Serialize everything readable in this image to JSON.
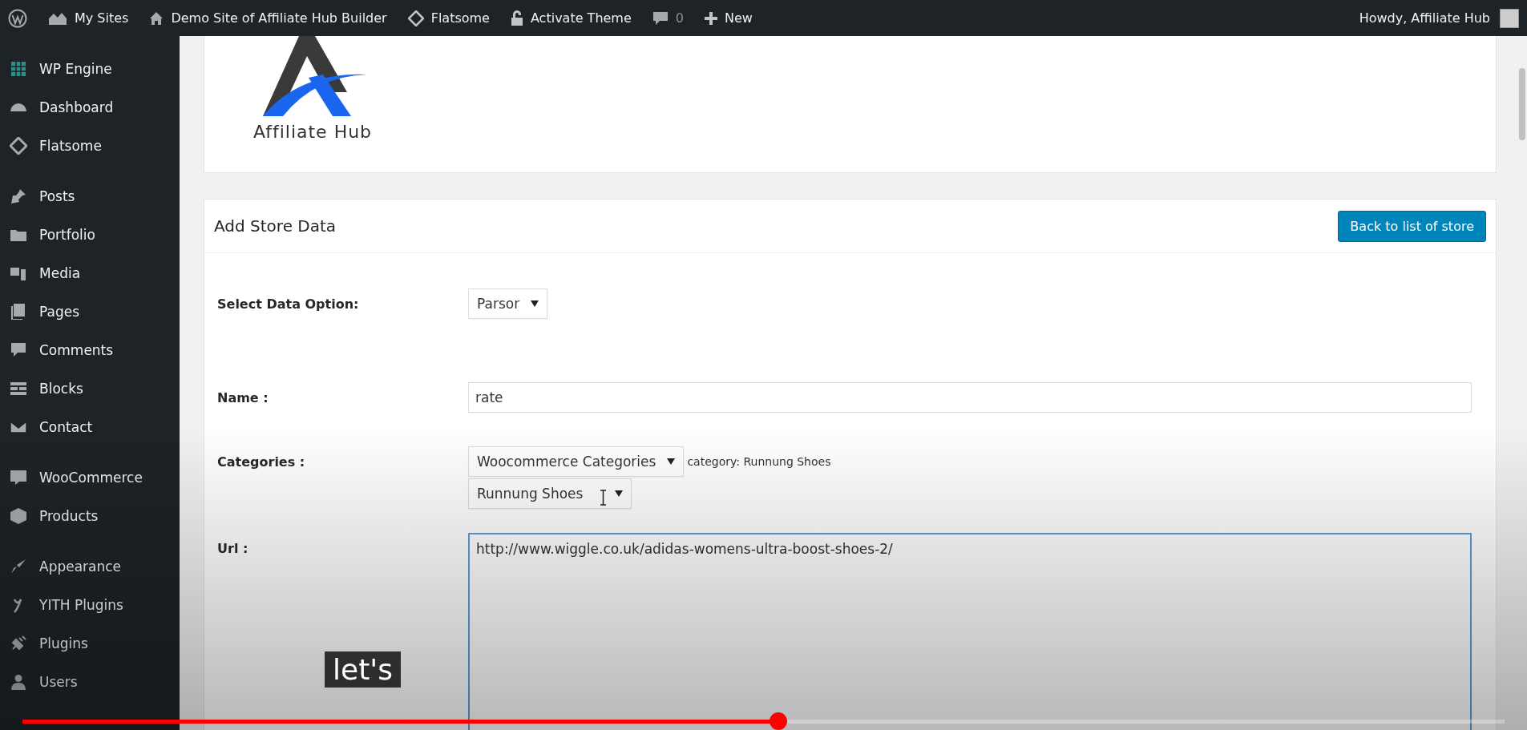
{
  "admin_bar": {
    "items": [
      {
        "kind": "logo"
      },
      {
        "kind": "sites",
        "label": "My Sites"
      },
      {
        "kind": "home",
        "label": "Demo Site of Affiliate Hub Builder"
      },
      {
        "kind": "flatsome",
        "label": "Flatsome"
      },
      {
        "kind": "lock",
        "label": "Activate Theme"
      },
      {
        "kind": "comments",
        "label": "0"
      },
      {
        "kind": "new",
        "label": "New"
      }
    ],
    "account": "Howdy, Affiliate Hub"
  },
  "sidebar": {
    "groups": [
      [
        {
          "label": "WP Engine"
        },
        {
          "label": "Dashboard"
        },
        {
          "label": "Flatsome"
        }
      ],
      [
        {
          "label": "Posts"
        },
        {
          "label": "Portfolio"
        },
        {
          "label": "Media"
        },
        {
          "label": "Pages"
        },
        {
          "label": "Comments"
        },
        {
          "label": "Blocks"
        },
        {
          "label": "Contact"
        }
      ],
      [
        {
          "label": "WooCommerce"
        },
        {
          "label": "Products"
        }
      ],
      [
        {
          "label": "Appearance"
        },
        {
          "label": "YITH Plugins"
        },
        {
          "label": "Plugins"
        },
        {
          "label": "Users"
        }
      ]
    ]
  },
  "logo": {
    "text": "Affiliate Hub"
  },
  "form": {
    "title": "Add Store Data",
    "back_button": "Back to list of store",
    "rows": [
      {
        "kind": "select",
        "label": "Select Data Option:",
        "value": "Parsor"
      },
      {
        "kind": "input",
        "label": "Name :",
        "value": "rate"
      },
      {
        "kind": "categories",
        "label": "Categories :",
        "value": "Woocommerce Categories",
        "note": "category: Runnung Shoes",
        "sub_value": "Runnung Shoes"
      },
      {
        "kind": "textarea",
        "label": "Url :",
        "value": "http://www.wiggle.co.uk/adidas-womens-ultra-boost-shoes-2/"
      }
    ]
  },
  "video": {
    "caption": "let's",
    "level": 0.51
  }
}
